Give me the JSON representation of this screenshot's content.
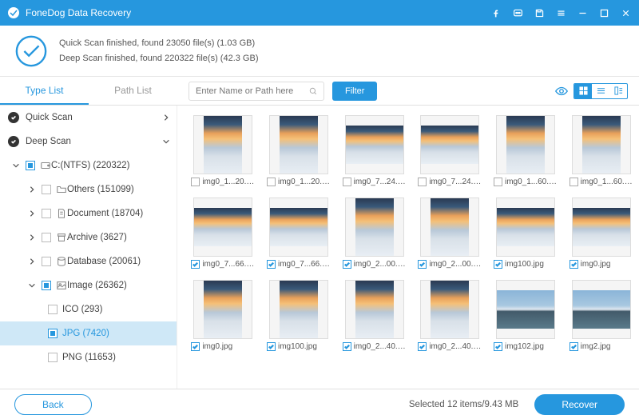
{
  "titlebar": {
    "title": "FoneDog Data Recovery"
  },
  "summary": {
    "line1": "Quick Scan finished, found 23050 file(s) (1.03 GB)",
    "line2": "Deep Scan finished, found 220322 file(s) (42.3 GB)"
  },
  "tabs": {
    "type_list": "Type List",
    "path_list": "Path List"
  },
  "search": {
    "placeholder": "Enter Name or Path here"
  },
  "filter": {
    "label": "Filter"
  },
  "tree": {
    "quick_scan": "Quick Scan",
    "deep_scan": "Deep Scan",
    "drive": "C:(NTFS) (220322)",
    "others": "Others (151099)",
    "document": "Document (18704)",
    "archive": "Archive (3627)",
    "database": "Database (20061)",
    "image": "Image (26362)",
    "ico": "ICO (293)",
    "jpg": "JPG (7420)",
    "png": "PNG (11653)"
  },
  "files": [
    {
      "name": "img0_1...20.jpg",
      "checked": false,
      "shape": "tall",
      "alt": false
    },
    {
      "name": "img0_1...20.jpg",
      "checked": false,
      "shape": "tall",
      "alt": false
    },
    {
      "name": "img0_7...24.jpg",
      "checked": false,
      "shape": "wide",
      "alt": false
    },
    {
      "name": "img0_7...24.jpg",
      "checked": false,
      "shape": "wide",
      "alt": false
    },
    {
      "name": "img0_1...60.jpg",
      "checked": false,
      "shape": "tall",
      "alt": false
    },
    {
      "name": "img0_1...60.jpg",
      "checked": false,
      "shape": "tall",
      "alt": false
    },
    {
      "name": "img0_7...66.jpg",
      "checked": true,
      "shape": "wide",
      "alt": false
    },
    {
      "name": "img0_7...66.jpg",
      "checked": true,
      "shape": "wide",
      "alt": false
    },
    {
      "name": "img0_2...00.jpg",
      "checked": true,
      "shape": "tall",
      "alt": false
    },
    {
      "name": "img0_2...00.jpg",
      "checked": true,
      "shape": "tall",
      "alt": false
    },
    {
      "name": "img100.jpg",
      "checked": true,
      "shape": "wide",
      "alt": false
    },
    {
      "name": "img0.jpg",
      "checked": true,
      "shape": "wide",
      "alt": false
    },
    {
      "name": "img0.jpg",
      "checked": true,
      "shape": "tall",
      "alt": false
    },
    {
      "name": "img100.jpg",
      "checked": true,
      "shape": "tall",
      "alt": false
    },
    {
      "name": "img0_2...40.jpg",
      "checked": true,
      "shape": "tall",
      "alt": false
    },
    {
      "name": "img0_2...40.jpg",
      "checked": true,
      "shape": "tall",
      "alt": false
    },
    {
      "name": "img102.jpg",
      "checked": true,
      "shape": "wide",
      "alt": true
    },
    {
      "name": "img2.jpg",
      "checked": true,
      "shape": "wide",
      "alt": true
    }
  ],
  "footer": {
    "back": "Back",
    "selected": "Selected 12 items/9.43 MB",
    "recover": "Recover"
  }
}
